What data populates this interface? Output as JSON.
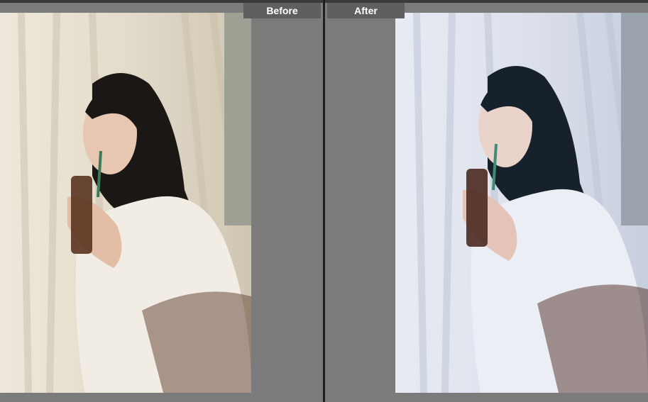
{
  "comparison": {
    "before_label": "Before",
    "after_label": "After"
  },
  "photos": {
    "before": {
      "icon": "portrait-photo-icon",
      "palette": {
        "curtain": "#e7e0d1",
        "curtain_shadow": "#c9bfaa",
        "sweater": "#f1ede5",
        "hair": "#1b1714",
        "skin": "#e8c7b2"
      }
    },
    "after": {
      "icon": "portrait-photo-icon",
      "palette": {
        "curtain": "#dfe3ee",
        "curtain_shadow": "#b9c1d3",
        "sweater": "#eceef6",
        "hair": "#16212b",
        "skin": "#ead3ca"
      }
    }
  }
}
